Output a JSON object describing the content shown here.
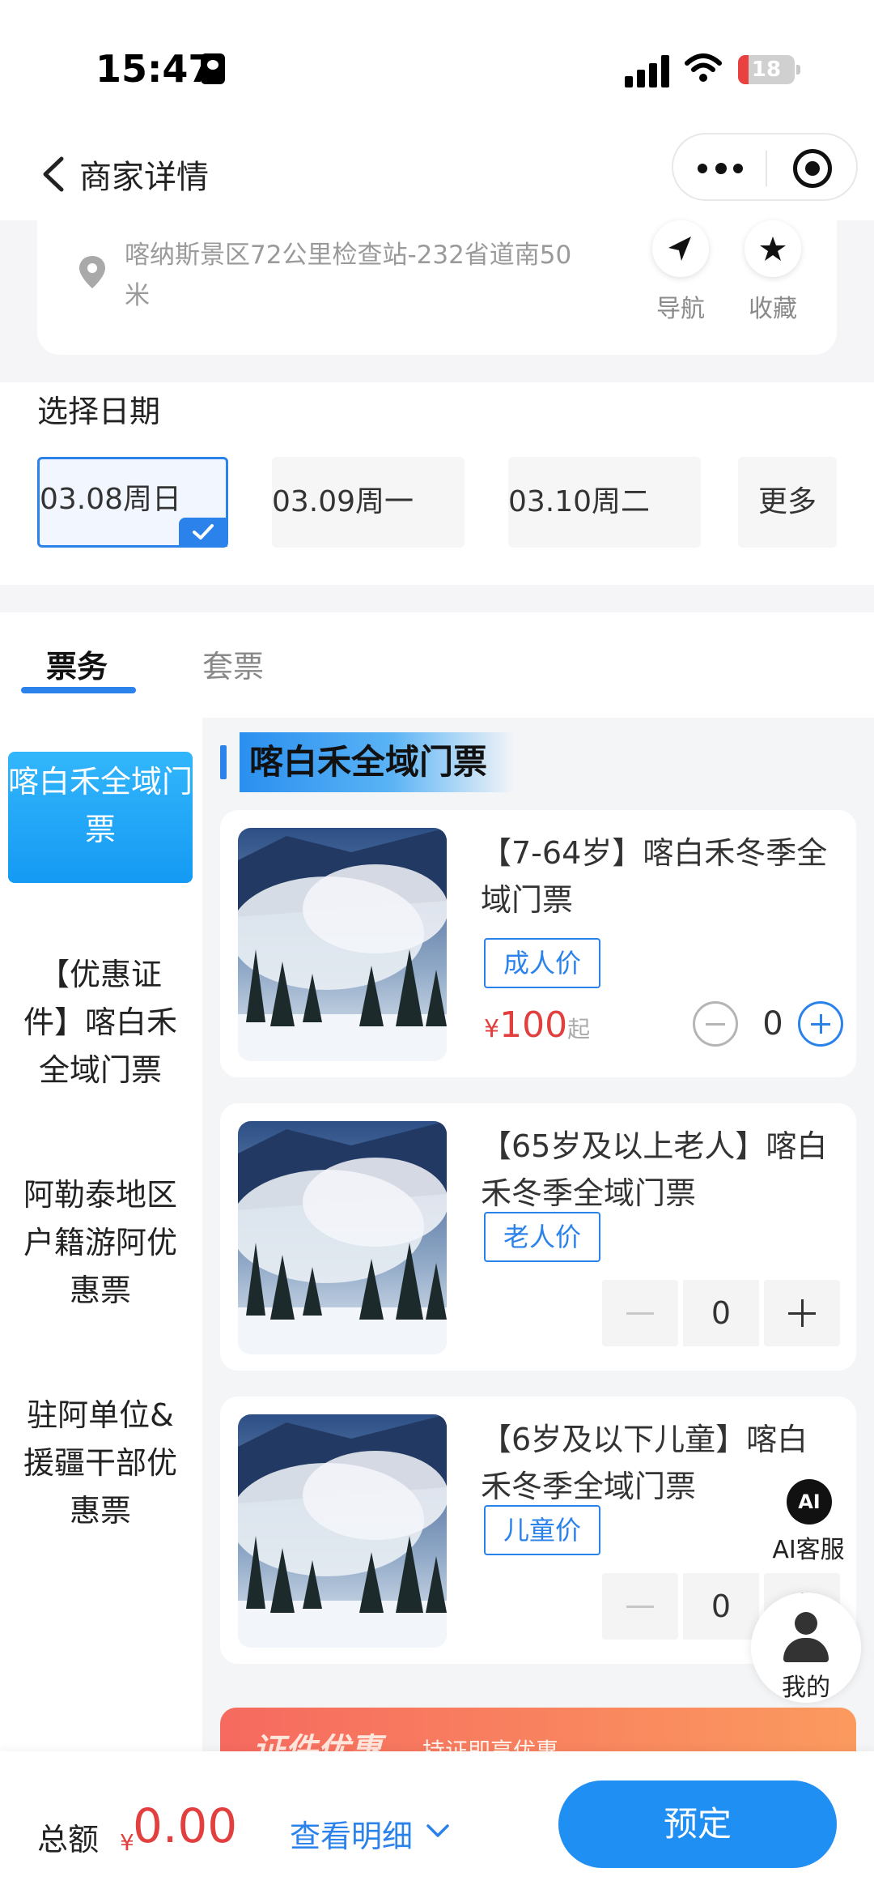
{
  "status_bar": {
    "time": "15:47",
    "battery": "18",
    "battery_level": 0.18
  },
  "nav": {
    "title": "商家详情",
    "icons": [
      "back-arrow-icon",
      "more-dots-icon",
      "target-icon"
    ]
  },
  "location": {
    "address": "喀纳斯景区72公里检查站-232省道南50米",
    "navigate_label": "导航",
    "favorite_label": "收藏"
  },
  "date_select": {
    "heading": "选择日期",
    "dates": [
      {
        "label": "03.08周日",
        "selected": true
      },
      {
        "label": "03.09周一",
        "selected": false
      },
      {
        "label": "03.10周二",
        "selected": false
      }
    ],
    "more_label": "更多"
  },
  "tabs": [
    {
      "label": "票务",
      "active": true
    },
    {
      "label": "套票",
      "active": false
    }
  ],
  "categories": [
    "喀白禾全域门票",
    "【优惠证件】喀白禾全域门票",
    "阿勒泰地区户籍游阿优惠票",
    "驻阿单位&援疆干部优惠票"
  ],
  "section_title": "喀白禾全域门票",
  "tickets": [
    {
      "name": "【7-64岁】喀白禾冬季全域门票",
      "tag": "成人价",
      "price_symbol": "¥",
      "price": "100",
      "price_suffix": "起",
      "qty": "0"
    },
    {
      "name": "【65岁及以上老人】喀白禾冬季全域门票",
      "tag": "老人价",
      "qty": "0"
    },
    {
      "name": "【6岁及以下儿童】喀白禾冬季全域门票",
      "tag": "儿童价",
      "qty": "0"
    }
  ],
  "promo": {
    "title": "证件优惠",
    "subtitle": "持证即享优惠"
  },
  "floating": {
    "ai_icon_text": "AI",
    "ai_label": "AI客服",
    "me_label": "我的"
  },
  "bottom": {
    "total_label": "总额",
    "currency": "¥",
    "total": "0.00",
    "detail_label": "查看明细",
    "book_label": "预定"
  },
  "colors": {
    "accent": "#2a82ea",
    "price": "#e23f3f",
    "book_button": "#1f8ff3"
  }
}
